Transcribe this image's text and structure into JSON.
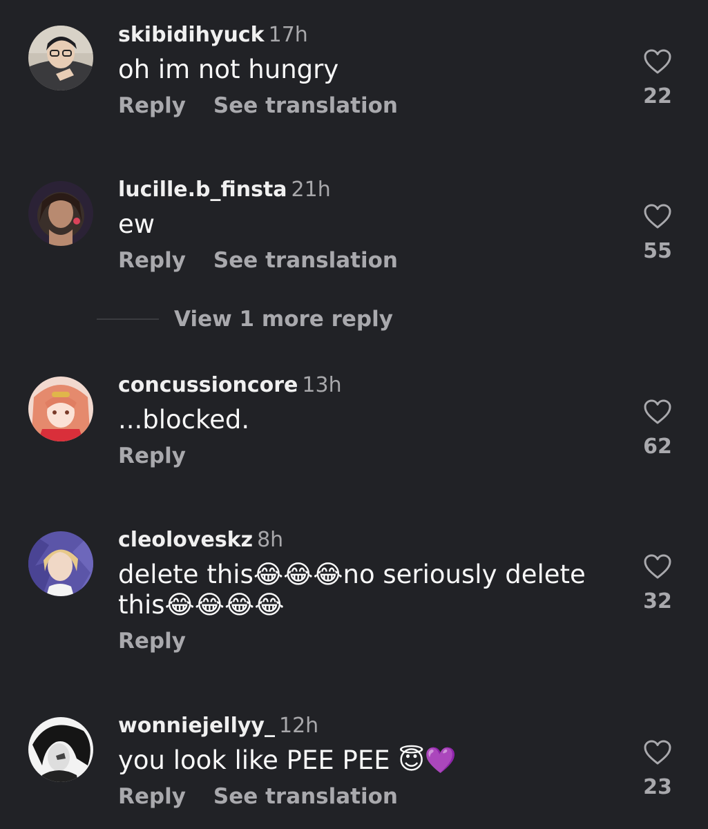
{
  "comments": [
    {
      "username": "skibidihyuck",
      "time": "17h",
      "text": "oh im not hungry",
      "reply_label": "Reply",
      "translate_label": "See translation",
      "likes": "22"
    },
    {
      "username": "lucille.b_finsta",
      "time": "21h",
      "text": "ew",
      "reply_label": "Reply",
      "translate_label": "See translation",
      "likes": "55",
      "more_replies_label": "View 1 more reply"
    },
    {
      "username": "concussioncore",
      "time": "13h",
      "text": "...blocked.",
      "reply_label": "Reply",
      "likes": "62"
    },
    {
      "username": "cleoloveskz",
      "time": "8h",
      "text_line1": "delete this😂😂😂no seriously delete",
      "text_line2": "this😂😂😂😂",
      "reply_label": "Reply",
      "likes": "32"
    },
    {
      "username": "wonniejellyy_",
      "time": "12h",
      "text": "you look like PEE PEE 😇💜",
      "reply_label": "Reply",
      "translate_label": "See translation",
      "likes": "23"
    }
  ],
  "icons": {
    "like": "heart-outline-icon"
  },
  "colors": {
    "background": "#212226",
    "username": "#f0f0f0",
    "secondary": "#a9a9ad"
  }
}
